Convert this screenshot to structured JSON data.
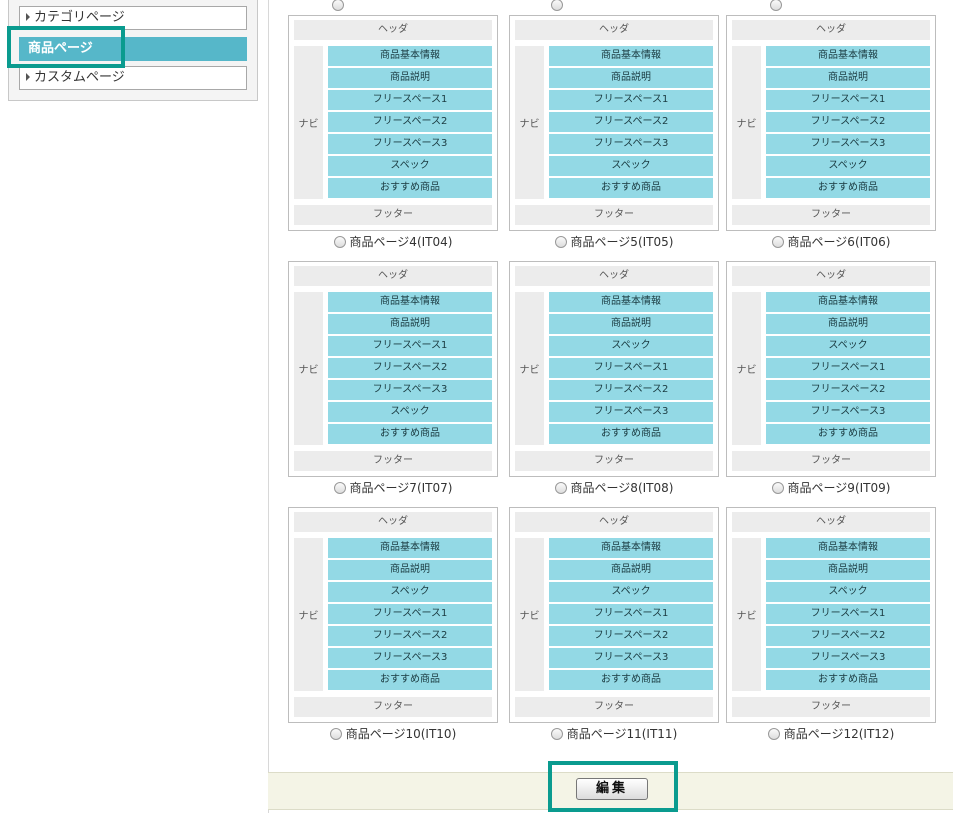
{
  "sidebar": {
    "items": [
      {
        "label": "カテゴリページ",
        "active": false
      },
      {
        "label": "商品ページ",
        "active": true
      },
      {
        "label": "カスタムページ",
        "active": false
      }
    ]
  },
  "layout_labels": {
    "header": "ヘッダ",
    "nav": "ナビ",
    "footer": "フッター"
  },
  "templates": [
    {
      "caption": "商品ページ4(IT04)",
      "blocks": [
        "商品基本情報",
        "商品説明",
        "フリースペース1",
        "フリースペース2",
        "フリースペース3",
        "スペック",
        "おすすめ商品"
      ]
    },
    {
      "caption": "商品ページ5(IT05)",
      "blocks": [
        "商品基本情報",
        "商品説明",
        "フリースペース1",
        "フリースペース2",
        "フリースペース3",
        "スペック",
        "おすすめ商品"
      ]
    },
    {
      "caption": "商品ページ6(IT06)",
      "blocks": [
        "商品基本情報",
        "商品説明",
        "フリースペース1",
        "フリースペース2",
        "フリースペース3",
        "スペック",
        "おすすめ商品"
      ]
    },
    {
      "caption": "商品ページ7(IT07)",
      "blocks": [
        "商品基本情報",
        "商品説明",
        "フリースペース1",
        "フリースペース2",
        "フリースペース3",
        "スペック",
        "おすすめ商品"
      ]
    },
    {
      "caption": "商品ページ8(IT08)",
      "blocks": [
        "商品基本情報",
        "商品説明",
        "スペック",
        "フリースペース1",
        "フリースペース2",
        "フリースペース3",
        "おすすめ商品"
      ]
    },
    {
      "caption": "商品ページ9(IT09)",
      "blocks": [
        "商品基本情報",
        "商品説明",
        "スペック",
        "フリースペース1",
        "フリースペース2",
        "フリースペース3",
        "おすすめ商品"
      ]
    },
    {
      "caption": "商品ページ10(IT10)",
      "blocks": [
        "商品基本情報",
        "商品説明",
        "スペック",
        "フリースペース1",
        "フリースペース2",
        "フリースペース3",
        "おすすめ商品"
      ]
    },
    {
      "caption": "商品ページ11(IT11)",
      "blocks": [
        "商品基本情報",
        "商品説明",
        "スペック",
        "フリースペース1",
        "フリースペース2",
        "フリースペース3",
        "おすすめ商品"
      ]
    },
    {
      "caption": "商品ページ12(IT12)",
      "blocks": [
        "商品基本情報",
        "商品説明",
        "スペック",
        "フリースペース1",
        "フリースペース2",
        "フリースペース3",
        "おすすめ商品"
      ]
    }
  ],
  "actions": {
    "edit_label": "編集"
  },
  "colors": {
    "highlight": "#0a9b8f",
    "active_item": "#56b7c9",
    "content_block": "#93d9e5"
  }
}
